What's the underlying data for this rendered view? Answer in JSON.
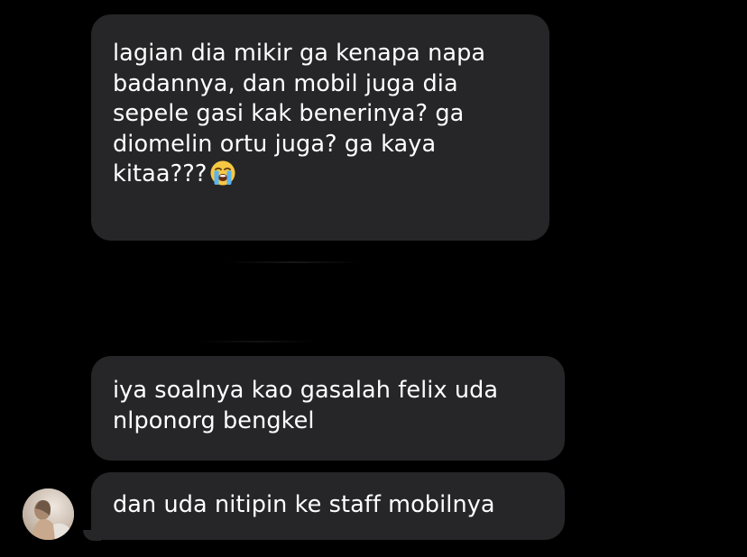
{
  "messages": [
    {
      "lines": [
        "lagian dia mikir ga kenapa napa",
        "badannya, dan mobil juga dia",
        "sepele gasi kak benerinya? ga",
        "diomelin ortu juga? ga kaya",
        "kitaa???"
      ],
      "emoji": "loudly-crying-face"
    },
    {
      "lines": [
        "iya soalnya kao gasalah felix uda",
        "nlponorg bengkel"
      ]
    },
    {
      "lines": [
        "dan uda nitipin ke staff mobilnya"
      ]
    }
  ],
  "colors": {
    "background": "#000000",
    "bubble": "#262628",
    "text": "#ffffff"
  }
}
